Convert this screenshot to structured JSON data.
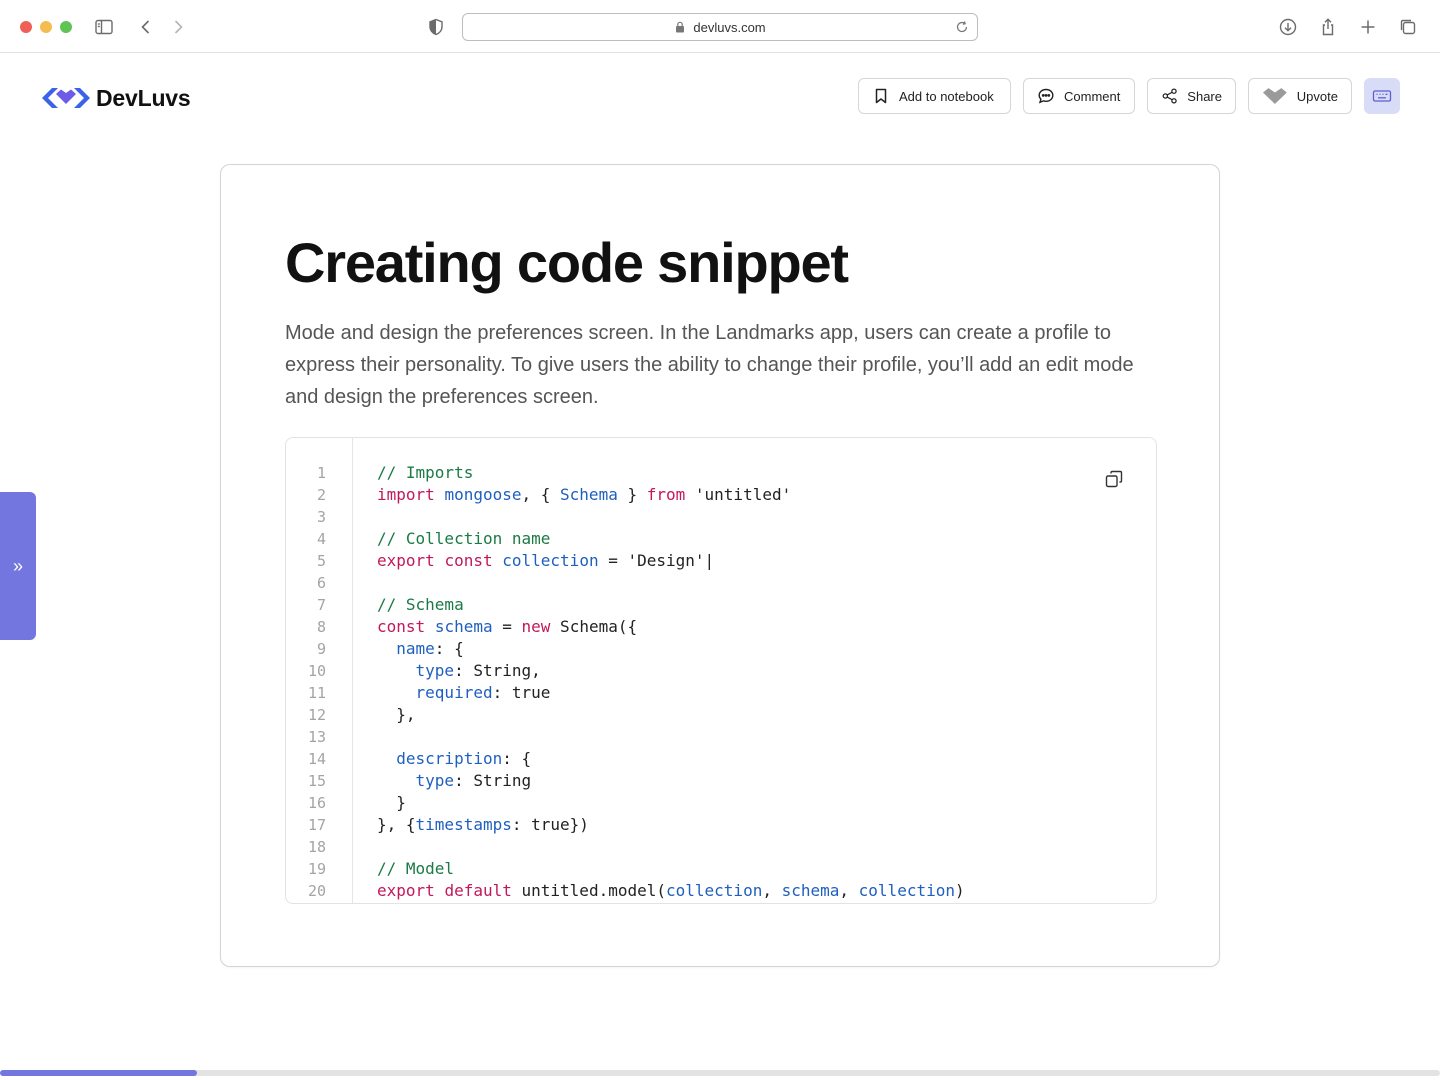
{
  "browser": {
    "url": "devluvs.com"
  },
  "header": {
    "logo_text": "DevLuvs",
    "buttons": {
      "notebook": "Add to notebook",
      "comment": "Comment",
      "share": "Share",
      "upvote": "Upvote"
    }
  },
  "side_tab": {
    "label": "»"
  },
  "article": {
    "title": "Creating code snippet",
    "description": "Mode and design the preferences screen. In the Landmarks app, users can create a profile to express their personality. To give users the ability to change their profile, you’ll add an edit mode and design the preferences screen."
  },
  "code": {
    "line_numbers": [
      "1",
      "2",
      "3",
      "4",
      "5",
      "6",
      "7",
      "8",
      "9",
      "10",
      "11",
      "12",
      "13",
      "14",
      "15",
      "16",
      "17",
      "18",
      "19",
      "20"
    ],
    "lines": [
      [
        [
          "com",
          "// Imports"
        ]
      ],
      [
        [
          "kw",
          "import"
        ],
        [
          "p",
          " "
        ],
        [
          "id",
          "mongoose"
        ],
        [
          "p",
          ", { "
        ],
        [
          "id",
          "Schema"
        ],
        [
          "p",
          " } "
        ],
        [
          "kw",
          "from"
        ],
        [
          "p",
          " 'untitled'"
        ]
      ],
      [],
      [
        [
          "com",
          "// Collection name"
        ]
      ],
      [
        [
          "kw",
          "export"
        ],
        [
          "p",
          " "
        ],
        [
          "kw",
          "const"
        ],
        [
          "p",
          " "
        ],
        [
          "id",
          "collection"
        ],
        [
          "p",
          " = 'Design'|"
        ]
      ],
      [],
      [
        [
          "com",
          "// Schema"
        ]
      ],
      [
        [
          "kw",
          "const"
        ],
        [
          "p",
          " "
        ],
        [
          "id",
          "schema"
        ],
        [
          "p",
          " = "
        ],
        [
          "kw",
          "new"
        ],
        [
          "p",
          " Schema({"
        ]
      ],
      [
        [
          "p",
          "  "
        ],
        [
          "id",
          "name"
        ],
        [
          "p",
          ": {"
        ]
      ],
      [
        [
          "p",
          "    "
        ],
        [
          "id",
          "type"
        ],
        [
          "p",
          ": String,"
        ]
      ],
      [
        [
          "p",
          "    "
        ],
        [
          "id",
          "required"
        ],
        [
          "p",
          ": true"
        ]
      ],
      [
        [
          "p",
          "  },"
        ]
      ],
      [],
      [
        [
          "p",
          "  "
        ],
        [
          "id",
          "description"
        ],
        [
          "p",
          ": {"
        ]
      ],
      [
        [
          "p",
          "    "
        ],
        [
          "id",
          "type"
        ],
        [
          "p",
          ": String"
        ]
      ],
      [
        [
          "p",
          "  }"
        ]
      ],
      [
        [
          "p",
          "}, {"
        ],
        [
          "id",
          "timestamps"
        ],
        [
          "p",
          ": true})"
        ]
      ],
      [],
      [
        [
          "com",
          "// Model"
        ]
      ],
      [
        [
          "kw",
          "export"
        ],
        [
          "p",
          " "
        ],
        [
          "kw",
          "default"
        ],
        [
          "p",
          " untitled.model("
        ],
        [
          "id",
          "collection"
        ],
        [
          "p",
          ", "
        ],
        [
          "id",
          "schema"
        ],
        [
          "p",
          ", "
        ],
        [
          "id",
          "collection"
        ],
        [
          "p",
          ")"
        ]
      ]
    ]
  },
  "reading_progress": 0.137,
  "colors": {
    "accent": "#7276de",
    "comment": "#1b7a45",
    "keyword": "#c2185b",
    "identifier": "#1e5fbf"
  },
  "icons": [
    "sidebar-icon",
    "back-icon",
    "forward-icon",
    "shield-icon",
    "lock-icon",
    "reload-icon",
    "download-icon",
    "share-icon",
    "new-tab-icon",
    "tabs-icon",
    "bookmark-icon",
    "comment-icon",
    "share-nodes-icon",
    "heart-icon",
    "keyboard-icon",
    "copy-icon"
  ]
}
